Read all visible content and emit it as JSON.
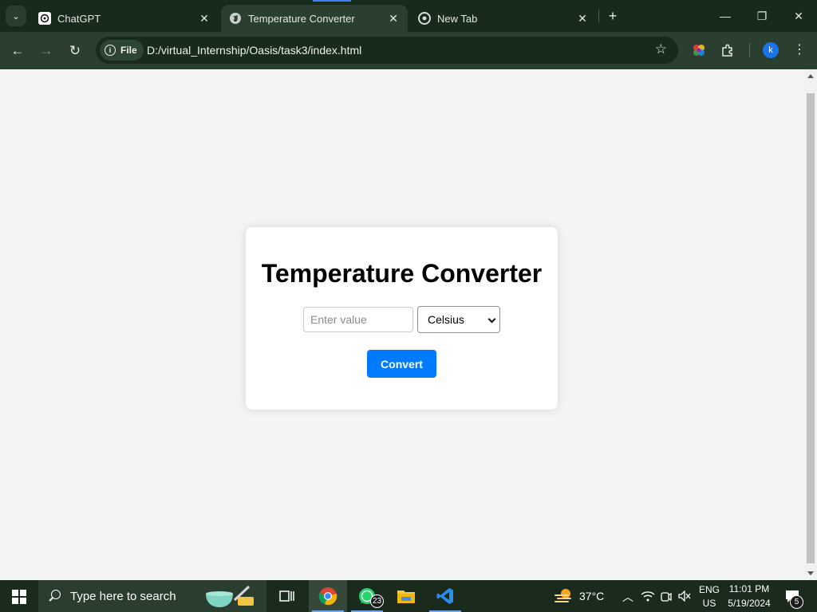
{
  "browser": {
    "tabs": [
      {
        "title": "ChatGPT",
        "icon": "chatgpt-icon",
        "active": false
      },
      {
        "title": "Temperature Converter",
        "icon": "globe-icon",
        "active": true
      },
      {
        "title": "New Tab",
        "icon": "chrome-icon",
        "active": false
      }
    ],
    "address": {
      "chip_label": "File",
      "url": "D:/virtual_Internship/Oasis/task3/index.html"
    },
    "profile_initial": "k"
  },
  "page": {
    "heading": "Temperature Converter",
    "input": {
      "placeholder": "Enter value",
      "value": ""
    },
    "unit_select": {
      "selected": "Celsius"
    },
    "convert_label": "Convert",
    "colors": {
      "background": "#f4f4f4",
      "card": "#ffffff",
      "button": "#007bff"
    }
  },
  "taskbar": {
    "search_placeholder": "Type here to search",
    "whatsapp_badge": "23",
    "weather": "37°C",
    "language": {
      "line1": "ENG",
      "line2": "US"
    },
    "clock": {
      "time": "11:01 PM",
      "date": "5/19/2024"
    },
    "notifications": "5"
  }
}
